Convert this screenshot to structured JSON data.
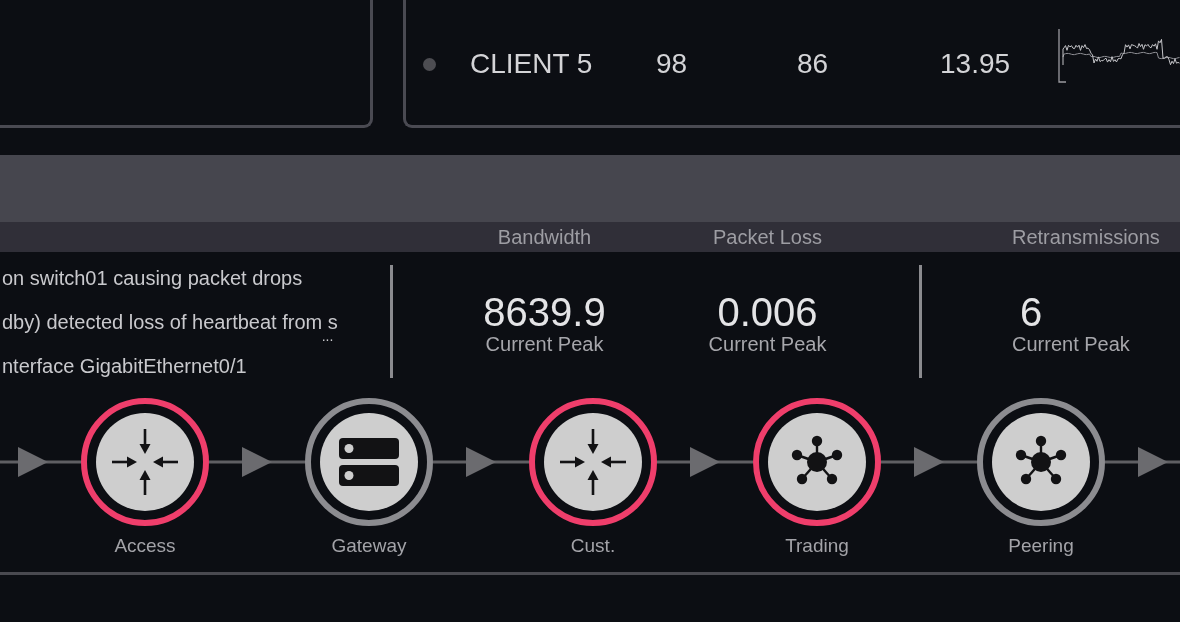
{
  "clients_panel": {
    "rows": [
      {
        "name": "CLIENT 5",
        "color": "#4d4d52",
        "values": [
          "98",
          "86",
          "13.95"
        ]
      }
    ]
  },
  "events": [
    {
      "text": "on switch01 causing packet drops"
    },
    {
      "text": "dby) detected loss of heartbeat from s",
      "more": "..."
    },
    {
      "text": "nterface GigabitEthernet0/1"
    }
  ],
  "metric_groups": [
    {
      "metrics": [
        {
          "heading": "Bandwidth",
          "value": "8639.9",
          "caption": "Current Peak"
        },
        {
          "heading": "Packet Loss",
          "value": "0.006",
          "caption": "Current Peak"
        }
      ]
    },
    {
      "metrics": [
        {
          "heading": "Retransmissions",
          "value": "6",
          "caption": "Current Peak"
        }
      ]
    }
  ],
  "flow": {
    "nodes": [
      {
        "label": "Access",
        "kind": "router",
        "alert": true
      },
      {
        "label": "Gateway",
        "kind": "server",
        "alert": false
      },
      {
        "label": "Cust.",
        "kind": "router",
        "alert": true
      },
      {
        "label": "Trading",
        "kind": "hub",
        "alert": true
      },
      {
        "label": "Peering",
        "kind": "hub",
        "alert": false
      }
    ]
  }
}
